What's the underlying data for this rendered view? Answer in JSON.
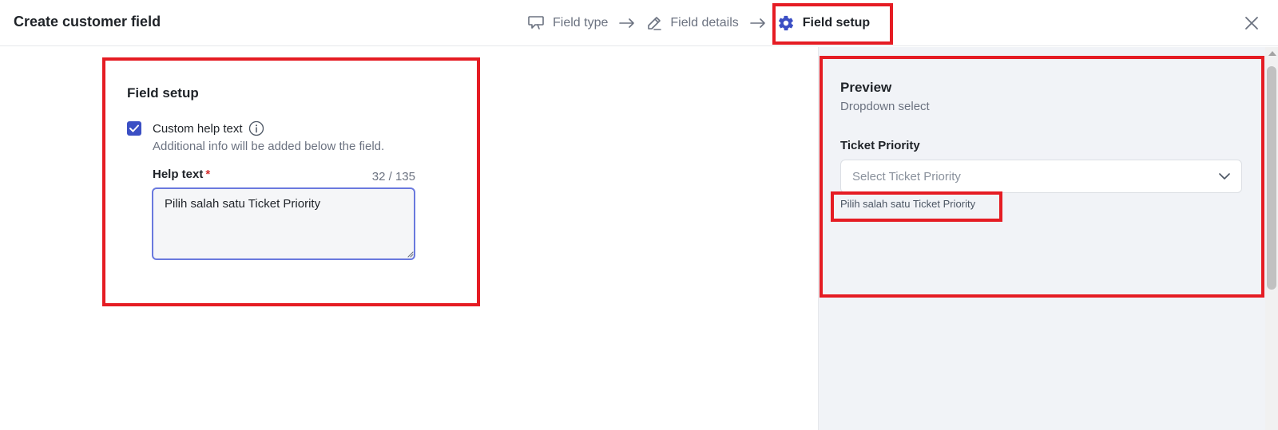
{
  "header": {
    "title": "Create customer field",
    "steps": [
      {
        "label": "Field type",
        "icon": "speech-bubble-icon",
        "active": false
      },
      {
        "label": "Field details",
        "icon": "pencil-icon",
        "active": false
      },
      {
        "label": "Field setup",
        "icon": "gear-icon",
        "active": true
      }
    ],
    "close_icon": "close-icon"
  },
  "field_setup": {
    "title": "Field setup",
    "custom_help_text": {
      "checked": true,
      "label": "Custom help text",
      "description": "Additional info will be added below the field."
    },
    "help_text": {
      "label": "Help text",
      "required_mark": "*",
      "counter": "32 / 135",
      "value": "Pilih salah satu Ticket Priority"
    }
  },
  "preview": {
    "title": "Preview",
    "subtitle": "Dropdown select",
    "field_label": "Ticket Priority",
    "select_placeholder": "Select Ticket Priority",
    "help_text": "Pilih salah satu Ticket Priority"
  },
  "colors": {
    "accent": "#3b4fc4",
    "highlight": "#e51c23",
    "required": "#d62c2c",
    "preview_bg": "#f1f3f7"
  }
}
